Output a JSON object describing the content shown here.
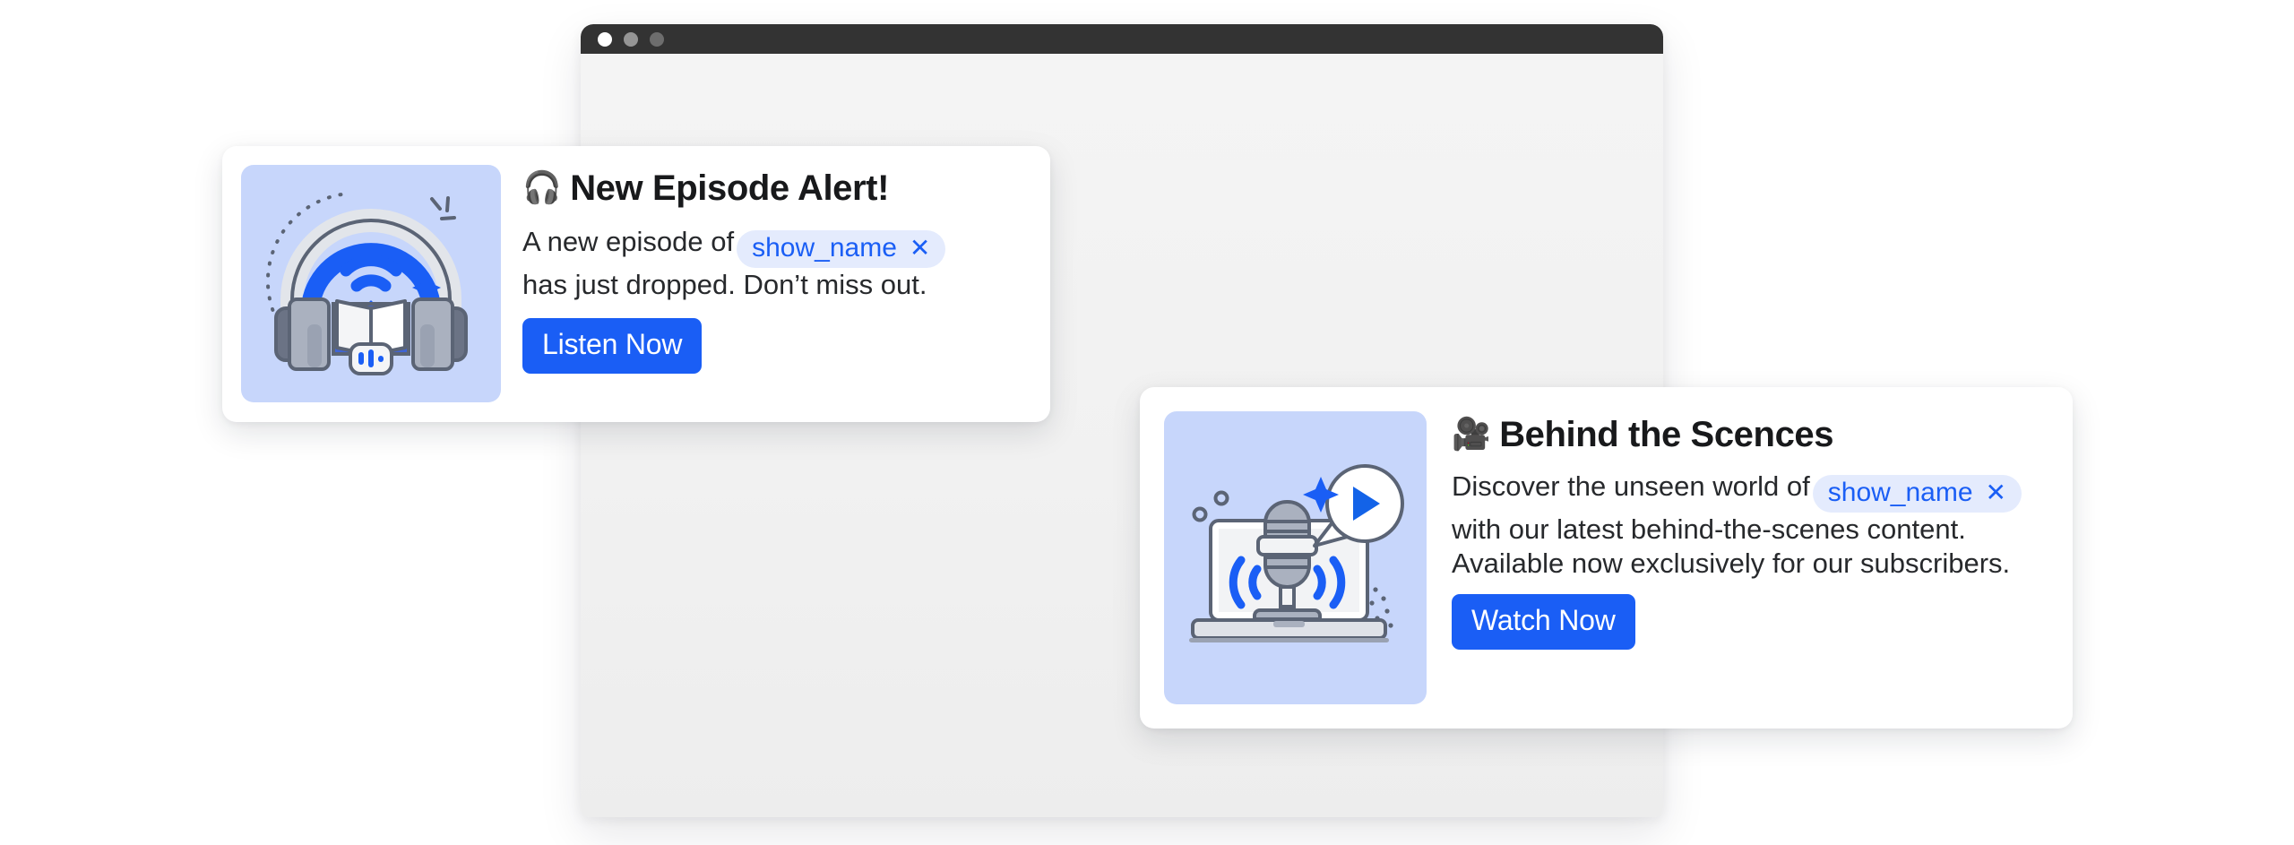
{
  "window": {
    "title_bar": {
      "buttons": [
        {
          "name": "close",
          "icon": "circle-icon",
          "color": "#ffffff"
        },
        {
          "name": "minimize",
          "icon": "circle-icon",
          "color": "#959595"
        },
        {
          "name": "maximize",
          "icon": "circle-icon",
          "color": "#6d6d6d"
        }
      ]
    },
    "body_color": "#f2f2f2"
  },
  "theme": {
    "accent": "#1a5ef5",
    "chip_bg": "#e4ebfd",
    "thumb_bg": "#c7d6fb",
    "text": "#27292c",
    "title_text": "#18191b"
  },
  "cards": [
    {
      "id": "new-episode-alert",
      "emoji": "🎧",
      "emoji_name": "headphone-emoji",
      "title": "New Episode Alert!",
      "illustration": "headphones-audiobook-illustration",
      "body_before_chip": "A new episode of",
      "chip": {
        "label": "show_name",
        "close": "✕"
      },
      "body_after_chip": "has just dropped. Don’t miss out.",
      "cta_label": "Listen Now"
    },
    {
      "id": "behind-the-scences",
      "emoji": "🎥",
      "emoji_name": "movie-camera-emoji",
      "title": "Behind the Scences",
      "illustration": "laptop-microphone-illustration",
      "body_before_chip": "Discover the unseen world of",
      "chip": {
        "label": "show_name",
        "close": "✕"
      },
      "body_after_chip": "with our latest behind-the-scenes content. Available now exclusively for our subscribers.",
      "cta_label": "Watch Now"
    }
  ]
}
